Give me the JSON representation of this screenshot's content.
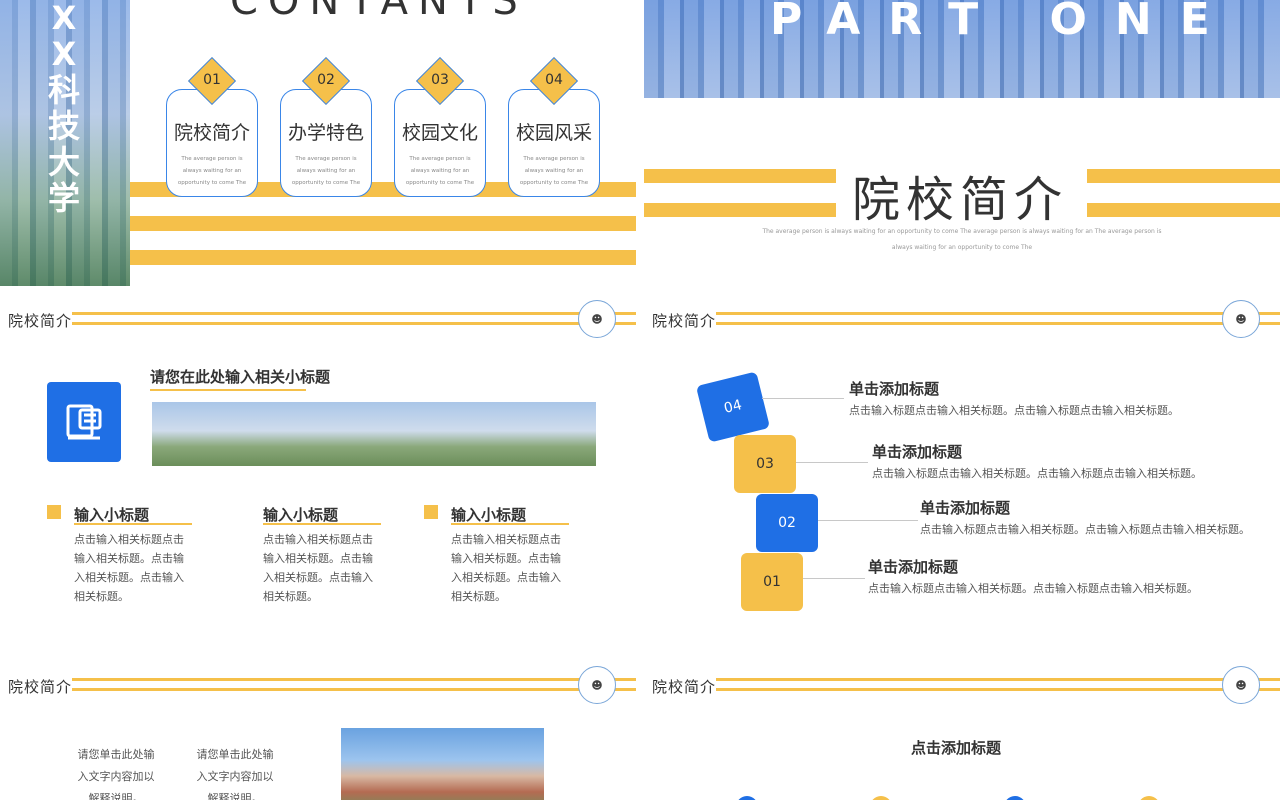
{
  "slide1": {
    "vertical_title": [
      "X",
      "X",
      "科",
      "技",
      "大",
      "学"
    ],
    "heading": "CONTANTS",
    "items": [
      {
        "num": "01",
        "title": "院校简介",
        "desc": "The average person is always waiting for an opportunity to come The"
      },
      {
        "num": "02",
        "title": "办学特色",
        "desc": "The average person is always waiting for an opportunity to come The"
      },
      {
        "num": "03",
        "title": "校园文化",
        "desc": "The average person is always waiting for an opportunity to come The"
      },
      {
        "num": "04",
        "title": "校园风采",
        "desc": "The average person is always waiting for an opportunity to come The"
      }
    ]
  },
  "slide2": {
    "banner": "PART ONE",
    "title": "院校简介",
    "desc_line1": "The average  person  is always  waiting  for an opportunity  to come The average  person  is always  waiting  for an The average  person  is",
    "desc_line2": "always waiting  for an opportunity  to come The"
  },
  "slide3": {
    "header": "院校简介",
    "main_subtitle": "请您在此处输入相关小标题",
    "columns": [
      {
        "title": "输入小标题",
        "body": "点击输入相关标题点击输入相关标题。点击输入相关标题。点击输入相关标题。"
      },
      {
        "title": "输入小标题",
        "body": "点击输入相关标题点击输入相关标题。点击输入相关标题。点击输入相关标题。"
      },
      {
        "title": "输入小标题",
        "body": "点击输入相关标题点击输入相关标题。点击输入相关标题。点击输入相关标题。"
      }
    ]
  },
  "slide4": {
    "header": "院校简介",
    "steps": [
      {
        "num": "04",
        "title": "单击添加标题",
        "body": "点击输入标题点击输入相关标题。点击输入标题点击输入相关标题。"
      },
      {
        "num": "03",
        "title": "单击添加标题",
        "body": "点击输入标题点击输入相关标题。点击输入标题点击输入相关标题。"
      },
      {
        "num": "02",
        "title": "单击添加标题",
        "body": "点击输入标题点击输入相关标题。点击输入标题点击输入相关标题。"
      },
      {
        "num": "01",
        "title": "单击添加标题",
        "body": "点击输入标题点击输入相关标题。点击输入标题点击输入相关标题。"
      }
    ]
  },
  "slide5": {
    "header": "院校简介",
    "text_a": [
      "请您单击此处输",
      "入文字内容加以",
      "解释说明。"
    ],
    "text_b": [
      "请您单击此处输",
      "入文字内容加以",
      "解释说明。"
    ]
  },
  "slide6": {
    "header": "院校简介",
    "title": "点击添加标题"
  },
  "colors": {
    "yellow": "#f5c04a",
    "blue": "#1f6fe5"
  }
}
